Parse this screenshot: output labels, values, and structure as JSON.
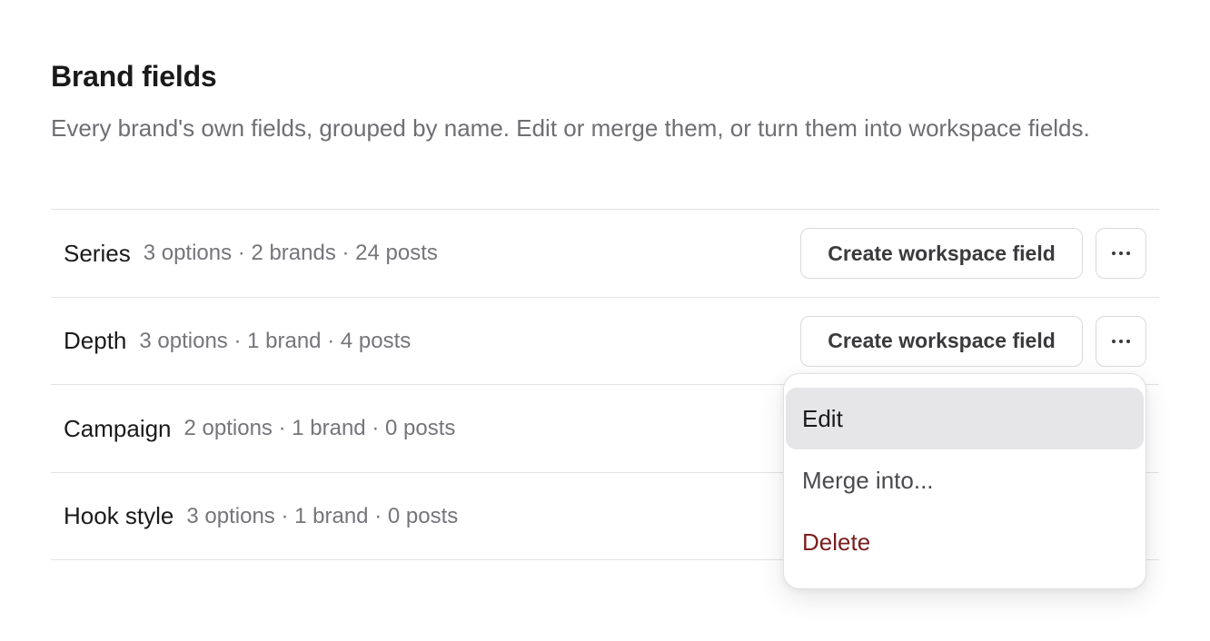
{
  "section": {
    "title": "Brand fields",
    "description": "Every brand's own fields, grouped by name. Edit or merge them, or turn them into workspace fields."
  },
  "rows": [
    {
      "name": "Series",
      "meta": "3 options · 2 brands · 24 posts",
      "create_label": "Create workspace field",
      "more_icon": "ellipsis-icon"
    },
    {
      "name": "Depth",
      "meta": "3 options · 1 brand · 4 posts",
      "create_label": "Create workspace field",
      "more_icon": "ellipsis-icon"
    },
    {
      "name": "Campaign",
      "meta": "2 options · 1 brand · 0 posts"
    },
    {
      "name": "Hook style",
      "meta": "3 options · 1 brand · 0 posts"
    }
  ],
  "menu": {
    "items": [
      {
        "label": "Edit",
        "state": "hovered"
      },
      {
        "label": "Merge into..."
      },
      {
        "label": "Delete",
        "color": "#7a1f1f"
      }
    ]
  },
  "colors": {
    "divider": "#e3e3e6",
    "muted_text": "#6e6e73",
    "danger": "#7a1f1f",
    "hover_bg": "#e6e6e8"
  }
}
